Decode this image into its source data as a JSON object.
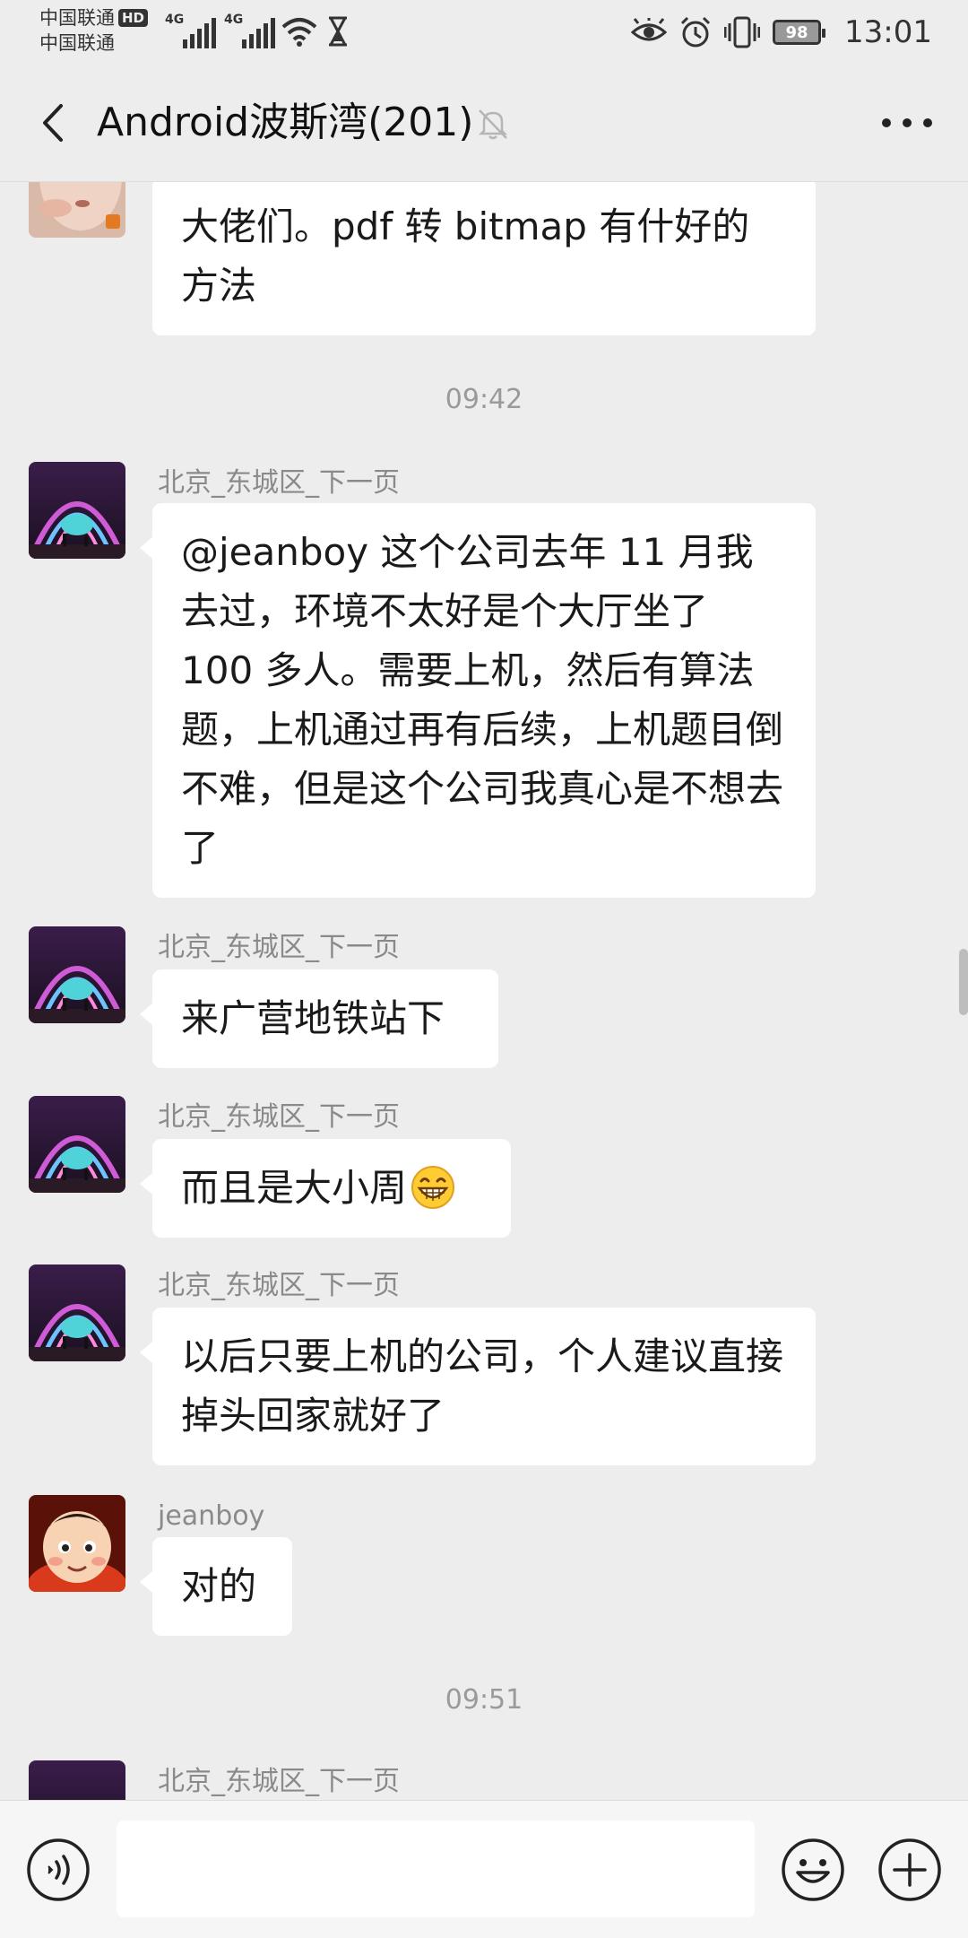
{
  "status_bar": {
    "carrier_1": "中国联通",
    "carrier_2": "中国联通",
    "hd_badge": "HD",
    "network_1": "4G",
    "network_2": "4G",
    "battery_level": "98",
    "time": "13:01",
    "icons": [
      "signal-icon",
      "wifi-icon",
      "hourglass-icon",
      "eye-icon",
      "alarm-icon",
      "vibrate-icon",
      "battery-icon"
    ]
  },
  "nav": {
    "title": "Android波斯湾(201)",
    "icons": [
      "back-icon",
      "mute-bell-icon",
      "more-icon"
    ]
  },
  "messages": [
    {
      "sender": "",
      "text": "大佬们。pdf 转 bitmap 有什好的方法"
    },
    {
      "sender": "北京_东城区_下一页",
      "text": "@jeanboy  这个公司去年 11 月我去过，环境不太好是个大厅坐了 100 多人。需要上机，然后有算法题，上机通过再有后续，上机题目倒不难，但是这个公司我真心是不想去了"
    },
    {
      "sender": "北京_东城区_下一页",
      "text": "来广营地铁站下"
    },
    {
      "sender": "北京_东城区_下一页",
      "text": "而且是大小周"
    },
    {
      "sender": "北京_东城区_下一页",
      "text": "以后只要上机的公司，个人建议直接掉头回家就好了"
    },
    {
      "sender": "jeanboy",
      "text": "对的"
    },
    {
      "sender": "北京_东城区_下一页",
      "text": ""
    }
  ],
  "timestamps": [
    "09:42",
    "09:51"
  ],
  "input_bar": {
    "text_value": "",
    "icons": [
      "voice-icon",
      "emoji-icon",
      "plus-icon"
    ]
  },
  "colors": {
    "background": "#ededed",
    "bubble": "#ffffff",
    "input_bar": "#f6f6f6"
  }
}
